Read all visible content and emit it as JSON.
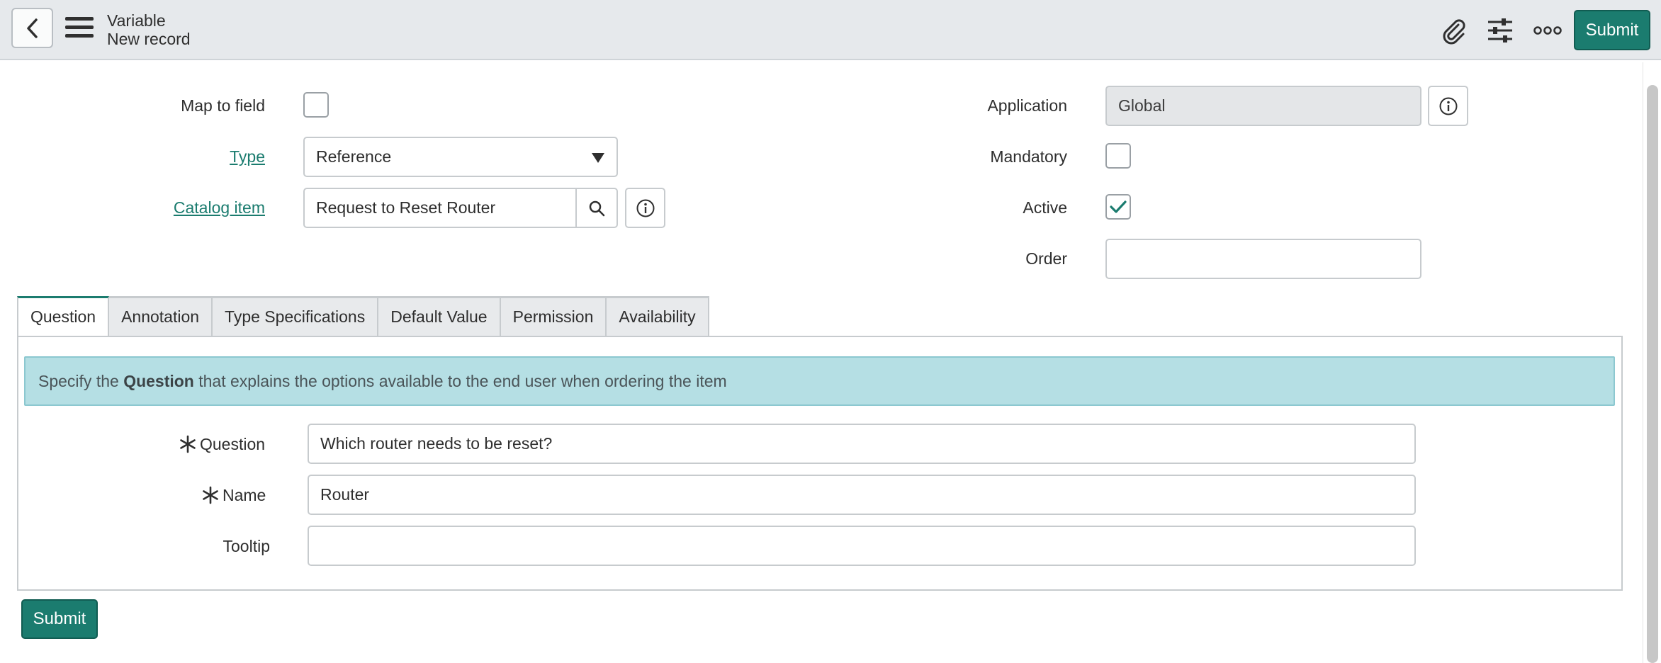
{
  "header": {
    "title": "Variable",
    "subtitle": "New record",
    "submit_label": "Submit",
    "icons": [
      "chevron-left-icon",
      "hamburger-menu-icon",
      "paperclip-icon",
      "sliders-icon",
      "more-icon"
    ]
  },
  "form": {
    "map_to_field": {
      "label": "Map to field",
      "checked": false
    },
    "type": {
      "label": "Type",
      "value": "Reference"
    },
    "catalog_item": {
      "label": "Catalog item",
      "value": "Request to Reset Router"
    },
    "application": {
      "label": "Application",
      "value": "Global"
    },
    "mandatory": {
      "label": "Mandatory",
      "checked": false
    },
    "active": {
      "label": "Active",
      "checked": true
    },
    "order": {
      "label": "Order",
      "value": ""
    }
  },
  "tabs": [
    {
      "label": "Question",
      "active": true
    },
    {
      "label": "Annotation",
      "active": false
    },
    {
      "label": "Type Specifications",
      "active": false
    },
    {
      "label": "Default Value",
      "active": false
    },
    {
      "label": "Permission",
      "active": false
    },
    {
      "label": "Availability",
      "active": false
    }
  ],
  "question_panel": {
    "banner_prefix": "Specify the ",
    "banner_bold": "Question",
    "banner_suffix": " that explains the options available to the end user when ordering the item",
    "question": {
      "label": "Question",
      "value": "Which router needs to be reset?",
      "required": true
    },
    "name": {
      "label": "Name",
      "value": "Router",
      "required": true
    },
    "tooltip": {
      "label": "Tooltip",
      "value": ""
    }
  },
  "footer": {
    "submit_label": "Submit"
  },
  "colors": {
    "accent": "#1b7c6f",
    "header_bg": "#e6e9ec",
    "banner_bg": "#b5dfe4"
  }
}
